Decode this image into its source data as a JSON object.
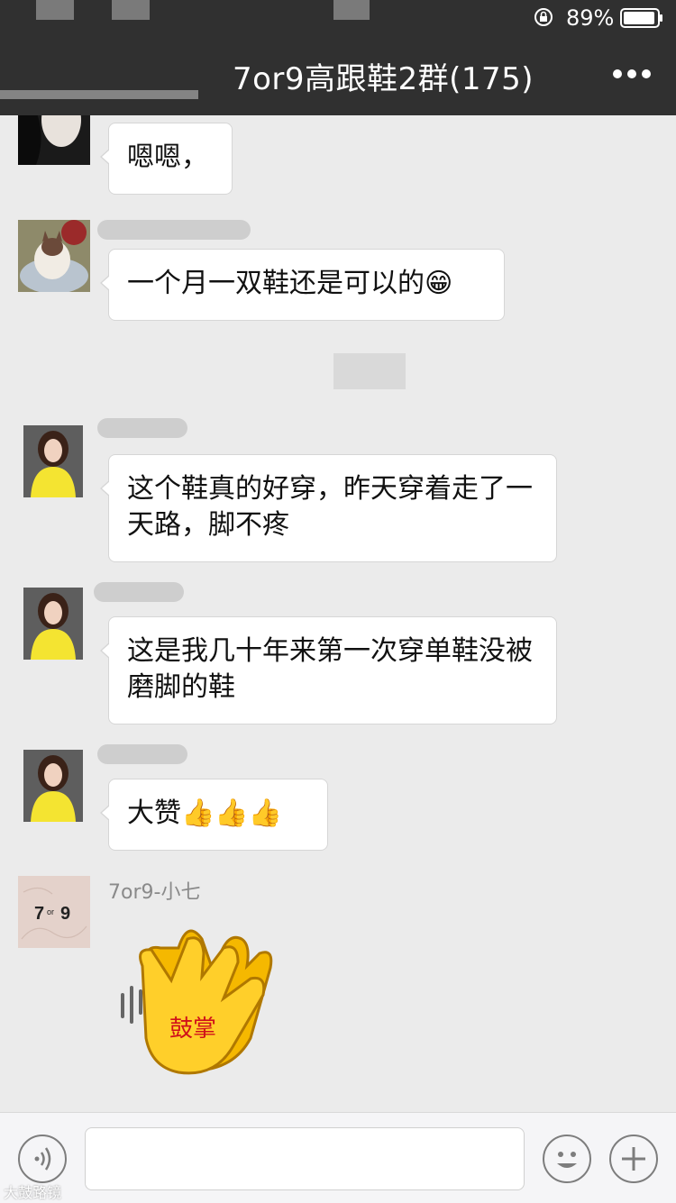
{
  "status_bar": {
    "battery_percent": "89%"
  },
  "nav": {
    "title": "7or9高跟鞋2群(175)"
  },
  "messages": [
    {
      "text": "嗯嗯，"
    },
    {
      "text": "一个月一双鞋还是可以的😁"
    },
    {
      "text": "这个鞋真的好穿，昨天穿着走了一天路，脚不疼"
    },
    {
      "text": "这是我几十年来第一次穿单鞋没被磨脚的鞋"
    },
    {
      "text": "大赞👍👍👍"
    },
    {
      "sender": "7or9-小七",
      "sticker_text": "鼓掌"
    }
  ],
  "avatar_logo": {
    "line1": "7",
    "line2": "or",
    "line3": "9"
  },
  "watermark": "大鼓路镜",
  "colors": {
    "nav_bg": "#303030",
    "chat_bg": "#ebebeb",
    "bubble": "#ffffff",
    "sticker_yellow": "#f5b800"
  }
}
